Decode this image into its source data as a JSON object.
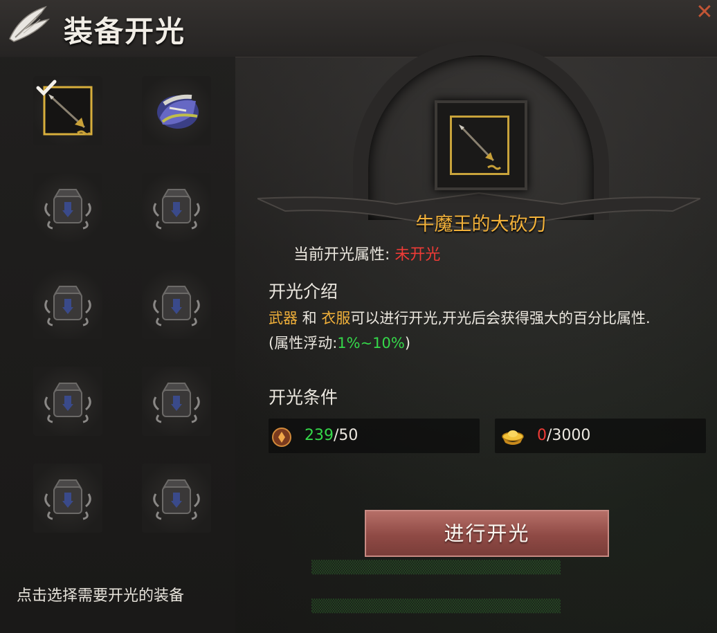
{
  "header": {
    "title": "装备开光",
    "close_icon": "close-x-icon"
  },
  "slots": [
    {
      "type": "equipped",
      "icon": "golden-spear-icon",
      "selected": true
    },
    {
      "type": "equipped",
      "icon": "blue-armor-icon",
      "selected": false
    },
    {
      "type": "locked",
      "icon": "locked-slot-icon"
    },
    {
      "type": "locked",
      "icon": "locked-slot-icon"
    },
    {
      "type": "locked",
      "icon": "locked-slot-icon"
    },
    {
      "type": "locked",
      "icon": "locked-slot-icon"
    },
    {
      "type": "locked",
      "icon": "locked-slot-icon"
    },
    {
      "type": "locked",
      "icon": "locked-slot-icon"
    },
    {
      "type": "locked",
      "icon": "locked-slot-icon"
    },
    {
      "type": "locked",
      "icon": "locked-slot-icon"
    }
  ],
  "hint": "点击选择需要开光的装备",
  "detail": {
    "item_name": "牛魔王的大砍刀",
    "current_attr_label": "当前开光属性:",
    "current_attr_value": "未开光",
    "intro_title": "开光介绍",
    "intro": {
      "hl1": "武器",
      "and": " 和 ",
      "hl2": "衣服",
      "rest": "可以进行开光,开光后会获得强大的百分比属性."
    },
    "float": {
      "prefix": "(属性浮动:",
      "range": "1%~10%",
      "suffix": ")"
    },
    "cond_title": "开光条件",
    "conditions": [
      {
        "icon": "orb-material-icon",
        "have": "239",
        "need": "/50",
        "ok": true
      },
      {
        "icon": "gold-ingot-icon",
        "have": "0",
        "need": "/3000",
        "ok": false
      }
    ],
    "action_label": "进行开光"
  },
  "colors": {
    "accent_gold": "#f2b13a",
    "warning_red": "#ef3b36",
    "ok_green": "#35d84a",
    "button": "#8f4a45"
  }
}
